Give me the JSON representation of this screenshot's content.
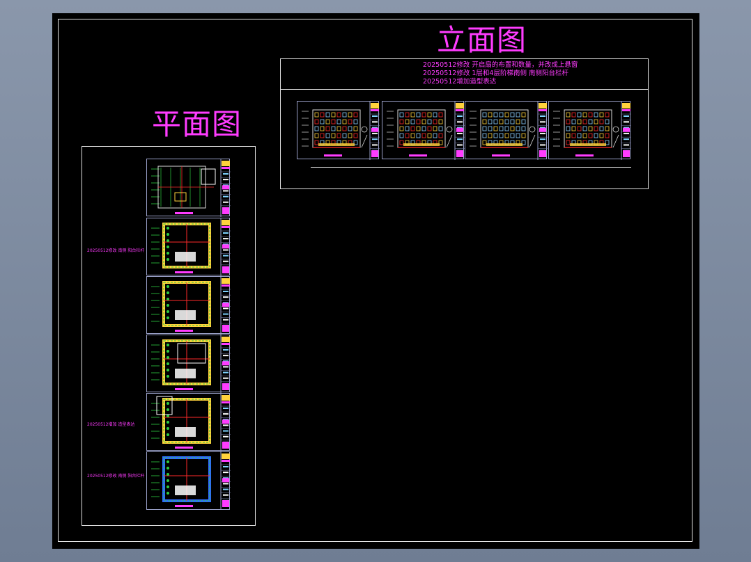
{
  "elevation": {
    "title": "立面图",
    "notes": [
      "20250512修改 开启扇的布置和数量，并改成上悬窗",
      "20250512修改 1层和4层阶梯南侧 南侧阳台栏杆",
      "20250512增加造型表达"
    ]
  },
  "plan": {
    "title": "平面图",
    "side_notes": [
      "20250512修改 南侧 阳台栏杆",
      "20250512增加 造型表达",
      "20250512修改 南侧 阳台栏杆"
    ]
  },
  "colors": {
    "background": "#000000",
    "annotation": "#ff3cff",
    "border": "#e0e0e0",
    "plan_wall": "#ffd23c",
    "plan_green": "#2ecc40",
    "grid_red": "#ff2a2a",
    "viewer_bg": "#7d8aa0"
  }
}
